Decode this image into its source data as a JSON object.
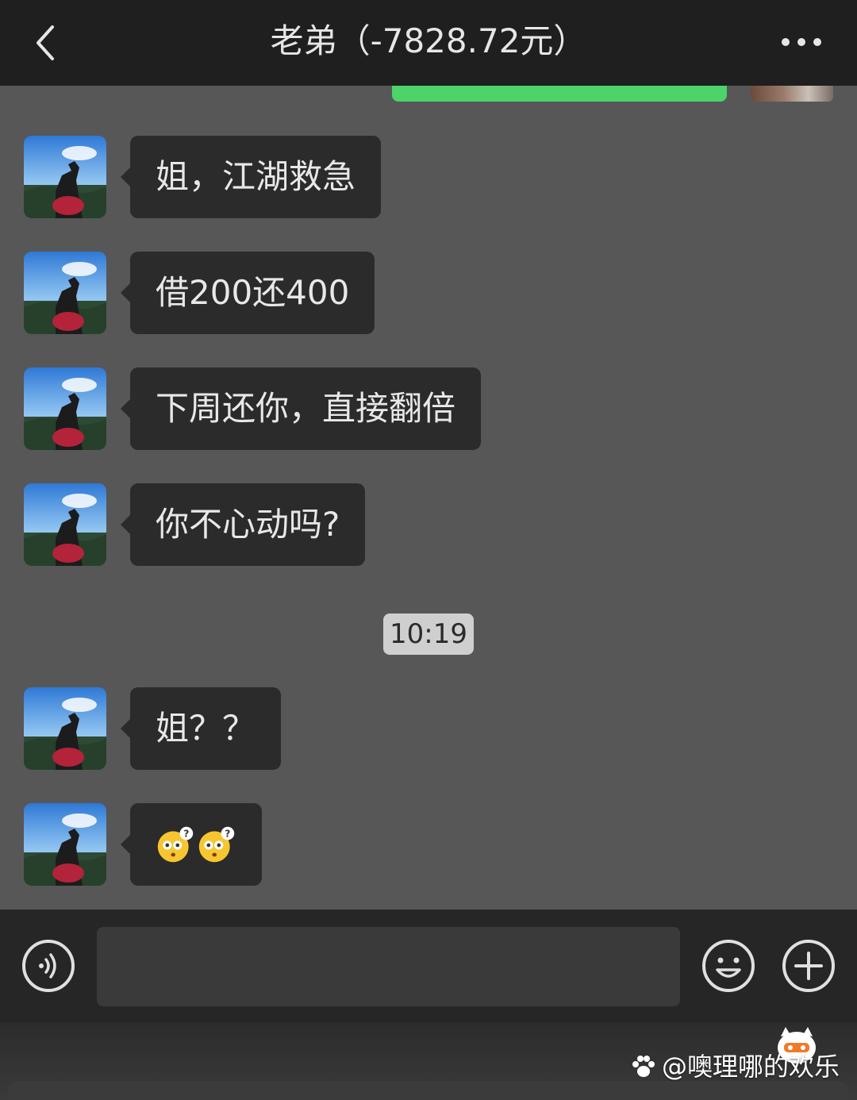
{
  "header": {
    "title": "老弟（-7828.72元）"
  },
  "messages": [
    {
      "text": "姐，江湖救急"
    },
    {
      "text": "借200还400"
    },
    {
      "text": "下周还你，直接翻倍"
    },
    {
      "text": "你不心动吗?"
    },
    {
      "text": "姐？？"
    }
  ],
  "emoji_message": {
    "emojis": [
      "confused-face-emoji",
      "confused-face-emoji"
    ]
  },
  "timestamp": "10:19",
  "input": {
    "value": "",
    "placeholder": ""
  },
  "icons": {
    "back": "chevron-left-icon",
    "more": "more-dots-icon",
    "voice": "voice-icon",
    "emoji": "smile-icon",
    "plus": "plus-icon"
  },
  "watermark": {
    "text": "@噢理哪的欢乐"
  },
  "colors": {
    "header_bg": "#1f1f1f",
    "chat_bg": "#575757",
    "bubble_bg": "#2b2b2b",
    "accent_green": "#4cd36a",
    "timestamp_bg": "#cfcfcf"
  }
}
